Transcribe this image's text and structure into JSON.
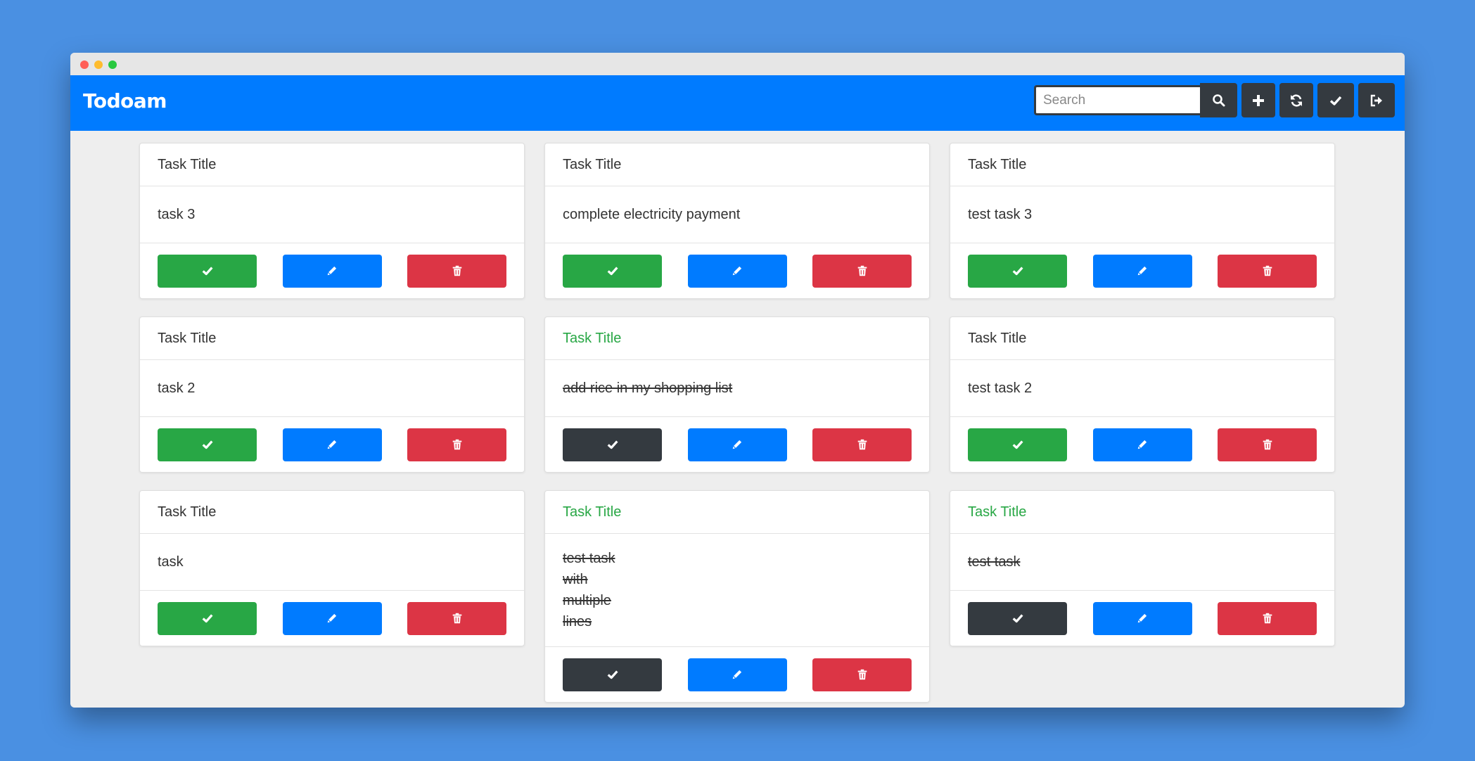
{
  "app": {
    "brand": "Todoam"
  },
  "search": {
    "placeholder": "Search",
    "value": ""
  },
  "toolbar_icons": [
    "search-icon",
    "plus-icon",
    "refresh-icon",
    "check-icon",
    "sign-out-icon"
  ],
  "colors": {
    "primary": "#007bff",
    "success": "#28a745",
    "danger": "#dc3545",
    "dark": "#343a40",
    "background": "#4a90e2"
  },
  "cards": [
    {
      "title": "Task Title",
      "lines": [
        "task 3"
      ],
      "completed": false
    },
    {
      "title": "Task Title",
      "lines": [
        "complete electricity payment"
      ],
      "completed": false
    },
    {
      "title": "Task Title",
      "lines": [
        "test task 3"
      ],
      "completed": false
    },
    {
      "title": "Task Title",
      "lines": [
        "task 2"
      ],
      "completed": false
    },
    {
      "title": "Task Title",
      "lines": [
        "add rice in my shopping list"
      ],
      "completed": true
    },
    {
      "title": "Task Title",
      "lines": [
        "test task 2"
      ],
      "completed": false
    },
    {
      "title": "Task Title",
      "lines": [
        "task"
      ],
      "completed": false
    },
    {
      "title": "Task Title",
      "lines": [
        "test task",
        "with",
        "multiple",
        "lines"
      ],
      "completed": true
    },
    {
      "title": "Task Title",
      "lines": [
        "test task"
      ],
      "completed": true
    }
  ]
}
